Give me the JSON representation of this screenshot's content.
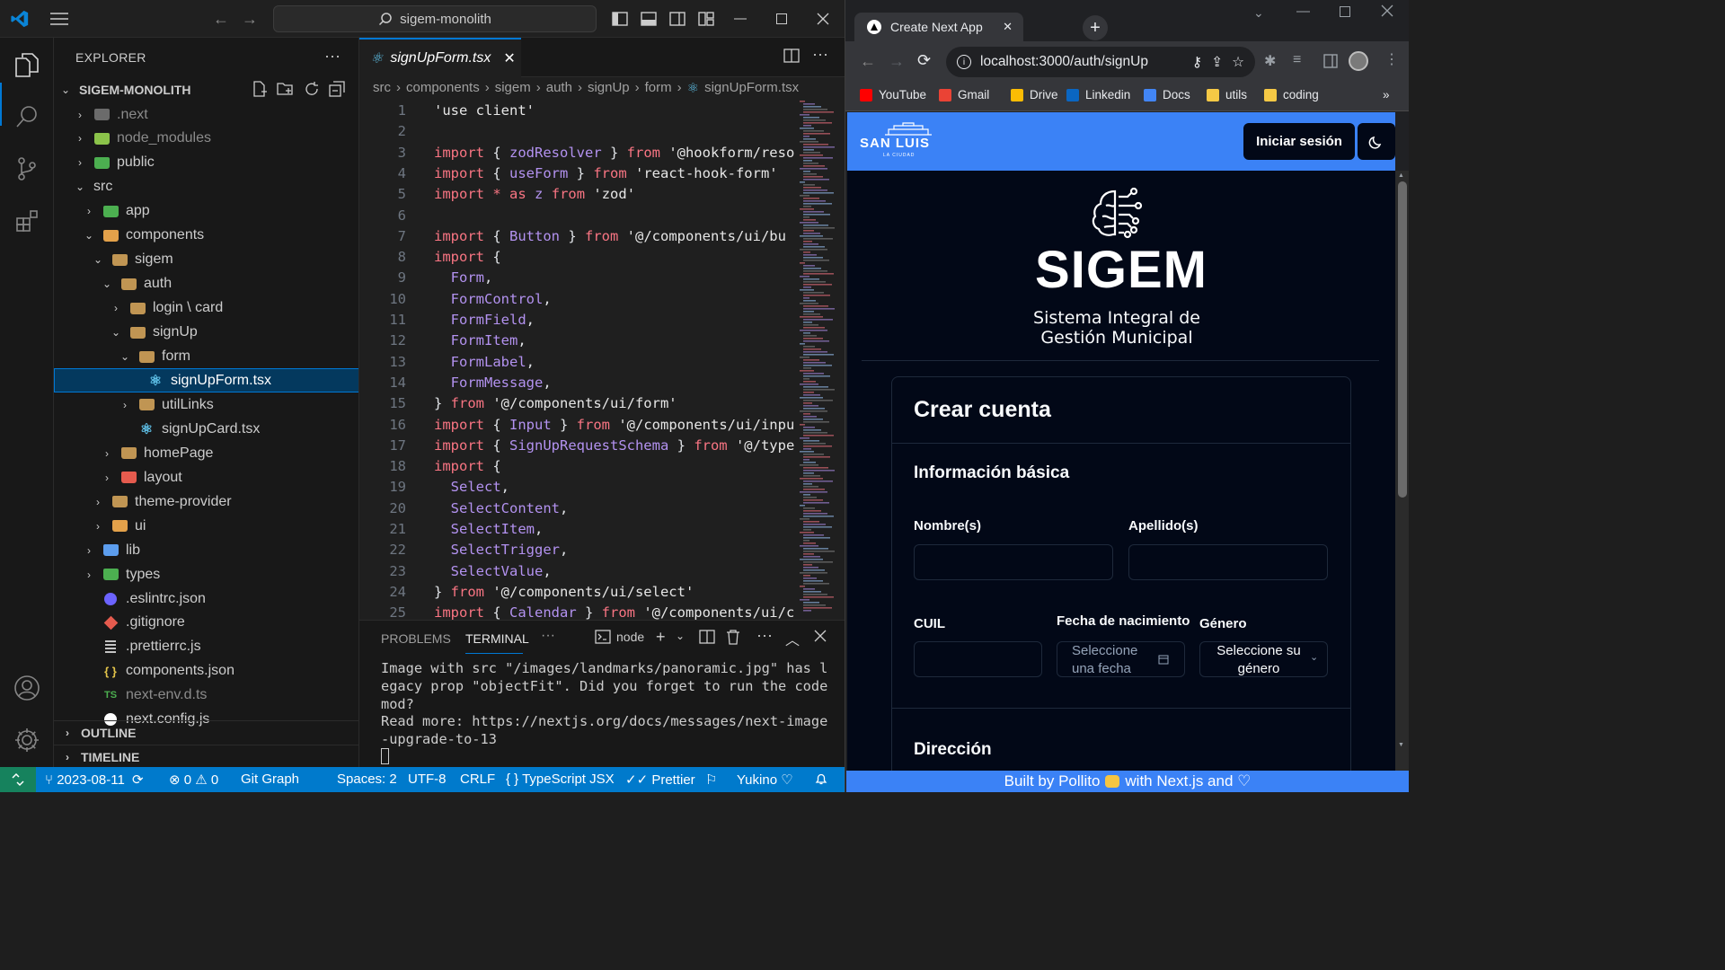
{
  "vscode": {
    "title": "sigem-monolith",
    "sidebar": {
      "title": "EXPLORER",
      "project": "SIGEM-MONOLITH",
      "tree": [
        {
          "label": ".next",
          "depth": 1,
          "chevron": ">",
          "icon": "folder-next",
          "dim": true
        },
        {
          "label": "node_modules",
          "depth": 1,
          "chevron": ">",
          "icon": "folder-node",
          "dim": true
        },
        {
          "label": "public",
          "depth": 1,
          "chevron": ">",
          "icon": "folder-public"
        },
        {
          "label": "src",
          "depth": 1,
          "chevron": "v",
          "icon": "none"
        },
        {
          "label": "app",
          "depth": 2,
          "chevron": ">",
          "icon": "folder-app"
        },
        {
          "label": "components",
          "depth": 2,
          "chevron": "v",
          "icon": "folder-components"
        },
        {
          "label": "sigem",
          "depth": 3,
          "chevron": "v",
          "icon": "folder"
        },
        {
          "label": "auth",
          "depth": 4,
          "chevron": "v",
          "icon": "folder"
        },
        {
          "label": "login \\ card",
          "depth": 5,
          "chevron": ">",
          "icon": "folder"
        },
        {
          "label": "signUp",
          "depth": 5,
          "chevron": "v",
          "icon": "folder"
        },
        {
          "label": "form",
          "depth": 6,
          "chevron": "v",
          "icon": "folder"
        },
        {
          "label": "signUpForm.tsx",
          "depth": 7,
          "chevron": "",
          "icon": "react",
          "selected": true
        },
        {
          "label": "utilLinks",
          "depth": 6,
          "chevron": ">",
          "icon": "folder"
        },
        {
          "label": "signUpCard.tsx",
          "depth": 6,
          "chevron": "",
          "icon": "react"
        },
        {
          "label": "homePage",
          "depth": 4,
          "chevron": ">",
          "icon": "folder"
        },
        {
          "label": "layout",
          "depth": 4,
          "chevron": ">",
          "icon": "folder-layout"
        },
        {
          "label": "theme-provider",
          "depth": 3,
          "chevron": ">",
          "icon": "folder"
        },
        {
          "label": "ui",
          "depth": 3,
          "chevron": ">",
          "icon": "folder-ui"
        },
        {
          "label": "lib",
          "depth": 2,
          "chevron": ">",
          "icon": "folder-lib"
        },
        {
          "label": "types",
          "depth": 2,
          "chevron": ">",
          "icon": "folder-types"
        },
        {
          "label": ".eslintrc.json",
          "depth": 2,
          "chevron": "",
          "icon": "eslint"
        },
        {
          "label": ".gitignore",
          "depth": 2,
          "chevron": "",
          "icon": "git"
        },
        {
          "label": ".prettierrc.js",
          "depth": 2,
          "chevron": "",
          "icon": "prettier"
        },
        {
          "label": "components.json",
          "depth": 2,
          "chevron": "",
          "icon": "json"
        },
        {
          "label": "next-env.d.ts",
          "depth": 2,
          "chevron": "",
          "icon": "ts",
          "dim": true
        },
        {
          "label": "next.config.js",
          "depth": 2,
          "chevron": "",
          "icon": "next"
        }
      ],
      "outline": "OUTLINE",
      "timeline": "TIMELINE"
    },
    "tab": {
      "label": "signUpForm.tsx"
    },
    "breadcrumb": [
      "src",
      "components",
      "sigem",
      "auth",
      "signUp",
      "form",
      "signUpForm.tsx"
    ],
    "code": [
      [
        [
          "str2",
          "'use client'"
        ]
      ],
      [],
      [
        [
          "kw",
          "import"
        ],
        [
          "pun",
          " { "
        ],
        [
          "id",
          "zodResolver"
        ],
        [
          "pun",
          " } "
        ],
        [
          "kw",
          "from"
        ],
        [
          "str2",
          " '@hookform/reso"
        ]
      ],
      [
        [
          "kw",
          "import"
        ],
        [
          "pun",
          " { "
        ],
        [
          "id",
          "useForm"
        ],
        [
          "pun",
          " } "
        ],
        [
          "kw",
          "from"
        ],
        [
          "str2",
          " 'react-hook-form'"
        ]
      ],
      [
        [
          "kw",
          "import"
        ],
        [
          "pun",
          " "
        ],
        [
          "kw",
          "*"
        ],
        [
          "pun",
          " "
        ],
        [
          "kw",
          "as"
        ],
        [
          "pun",
          " "
        ],
        [
          "id",
          "z"
        ],
        [
          "pun",
          " "
        ],
        [
          "kw",
          "from"
        ],
        [
          "str2",
          " 'zod'"
        ]
      ],
      [],
      [
        [
          "kw",
          "import"
        ],
        [
          "pun",
          " { "
        ],
        [
          "id",
          "Button"
        ],
        [
          "pun",
          " } "
        ],
        [
          "kw",
          "from"
        ],
        [
          "str2",
          " '@/components/ui/bu"
        ]
      ],
      [
        [
          "kw",
          "import"
        ],
        [
          "pun",
          " {"
        ]
      ],
      [
        [
          "pun",
          "  "
        ],
        [
          "id",
          "Form"
        ],
        [
          "pun",
          ","
        ]
      ],
      [
        [
          "pun",
          "  "
        ],
        [
          "id",
          "FormControl"
        ],
        [
          "pun",
          ","
        ]
      ],
      [
        [
          "pun",
          "  "
        ],
        [
          "id",
          "FormField"
        ],
        [
          "pun",
          ","
        ]
      ],
      [
        [
          "pun",
          "  "
        ],
        [
          "id",
          "FormItem"
        ],
        [
          "pun",
          ","
        ]
      ],
      [
        [
          "pun",
          "  "
        ],
        [
          "id",
          "FormLabel"
        ],
        [
          "pun",
          ","
        ]
      ],
      [
        [
          "pun",
          "  "
        ],
        [
          "id",
          "FormMessage"
        ],
        [
          "pun",
          ","
        ]
      ],
      [
        [
          "pun",
          "} "
        ],
        [
          "kw",
          "from"
        ],
        [
          "str2",
          " '@/components/ui/form'"
        ]
      ],
      [
        [
          "kw",
          "import"
        ],
        [
          "pun",
          " { "
        ],
        [
          "id",
          "Input"
        ],
        [
          "pun",
          " } "
        ],
        [
          "kw",
          "from"
        ],
        [
          "str2",
          " '@/components/ui/inpu"
        ]
      ],
      [
        [
          "kw",
          "import"
        ],
        [
          "pun",
          " { "
        ],
        [
          "id",
          "SignUpRequestSchema"
        ],
        [
          "pun",
          " } "
        ],
        [
          "kw",
          "from"
        ],
        [
          "str2",
          " '@/type"
        ]
      ],
      [
        [
          "kw",
          "import"
        ],
        [
          "pun",
          " {"
        ]
      ],
      [
        [
          "pun",
          "  "
        ],
        [
          "id",
          "Select"
        ],
        [
          "pun",
          ","
        ]
      ],
      [
        [
          "pun",
          "  "
        ],
        [
          "id",
          "SelectContent"
        ],
        [
          "pun",
          ","
        ]
      ],
      [
        [
          "pun",
          "  "
        ],
        [
          "id",
          "SelectItem"
        ],
        [
          "pun",
          ","
        ]
      ],
      [
        [
          "pun",
          "  "
        ],
        [
          "id",
          "SelectTrigger"
        ],
        [
          "pun",
          ","
        ]
      ],
      [
        [
          "pun",
          "  "
        ],
        [
          "id",
          "SelectValue"
        ],
        [
          "pun",
          ","
        ]
      ],
      [
        [
          "pun",
          "} "
        ],
        [
          "kw",
          "from"
        ],
        [
          "str2",
          " '@/components/ui/select'"
        ]
      ],
      [
        [
          "kw",
          "import"
        ],
        [
          "pun",
          " { "
        ],
        [
          "id",
          "Calendar"
        ],
        [
          "pun",
          " } "
        ],
        [
          "kw",
          "from"
        ],
        [
          "str2",
          " '@/components/ui/c"
        ]
      ]
    ],
    "panel": {
      "tabs": [
        "PROBLEMS",
        "TERMINAL"
      ],
      "more": "···",
      "shell": "node",
      "output": "Image with src \"/images/landmarks/panoramic.jpg\" has legacy prop \"objectFit\". Did you forget to run the codemod?\nRead more: https://nextjs.org/docs/messages/next-image-upgrade-to-13"
    },
    "status": {
      "branch": "2023-08-11",
      "errors": "0",
      "warnings": "0",
      "git_graph": "Git Graph",
      "spaces": "Spaces: 2",
      "encoding": "UTF-8",
      "eol": "CRLF",
      "language": "TypeScript JSX",
      "prettier": "Prettier",
      "theme": "Yukino"
    }
  },
  "browser": {
    "tab_title": "Create Next App",
    "url": "localhost:3000/auth/signUp",
    "bookmarks": [
      {
        "label": "YouTube",
        "color": "#ff0000"
      },
      {
        "label": "Gmail",
        "color": "#ea4335"
      },
      {
        "label": "Drive",
        "color": "#fbbc04"
      },
      {
        "label": "Linkedin",
        "color": "#0a66c2"
      },
      {
        "label": "Docs",
        "color": "#4285f4"
      },
      {
        "label": "utils",
        "color": "#f6c945"
      },
      {
        "label": "coding",
        "color": "#f6c945"
      }
    ],
    "page": {
      "logo": "SAN LUIS",
      "logo_sub": "LA CIUDAD",
      "login_button": "Iniciar sesión",
      "brand": "SIGEM",
      "subtitle_line1": "Sistema Integral de",
      "subtitle_line2": "Gestión Municipal",
      "card_title": "Crear cuenta",
      "section_basic": "Información básica",
      "label_first_name": "Nombre(s)",
      "label_last_name": "Apellido(s)",
      "label_cuil": "CUIL",
      "label_birth": "Fecha de nacimiento",
      "label_gender": "Género",
      "birth_placeholder_1": "Seleccione",
      "birth_placeholder_2": "una fecha",
      "gender_placeholder_1": "Seleccione su",
      "gender_placeholder_2": "género",
      "section_address": "Dirección",
      "footer": "Built by Pollito",
      "footer_tail": "with Next.js and ♡"
    },
    "colors": {
      "header": "#3b82f6",
      "page_bg": "#020817"
    }
  }
}
